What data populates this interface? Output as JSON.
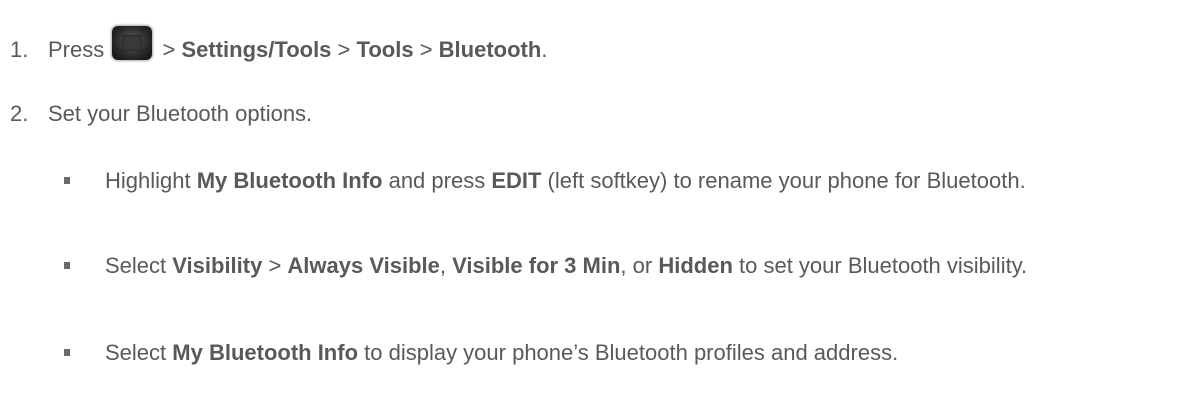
{
  "steps": [
    {
      "number": "1.",
      "press": "Press",
      "icon": "menu-key-icon",
      "sep1": ">",
      "settings_tools": "Settings/Tools",
      "sep2": ">",
      "tools": "Tools",
      "sep3": ">",
      "bluetooth": "Bluetooth",
      "end": "."
    },
    {
      "number": "2.",
      "text": "Set your Bluetooth options."
    }
  ],
  "bullets": [
    {
      "t1": "Highlight ",
      "b1": "My Bluetooth Info",
      "t2": " and press ",
      "b2": "EDIT",
      "t3": " (left softkey) to rename your phone for Bluetooth."
    },
    {
      "t1": "Select ",
      "b1": "Visibility",
      "t2": " > ",
      "b2": "Always Visible",
      "t3": ", ",
      "b3": "Visible for 3 Min",
      "t4": ", or ",
      "b4": "Hidden",
      "t5": " to set your Bluetooth visibility."
    },
    {
      "t1": "Select ",
      "b1": "My Bluetooth Info",
      "t2": " to display your phone’s Bluetooth profiles and address."
    }
  ]
}
